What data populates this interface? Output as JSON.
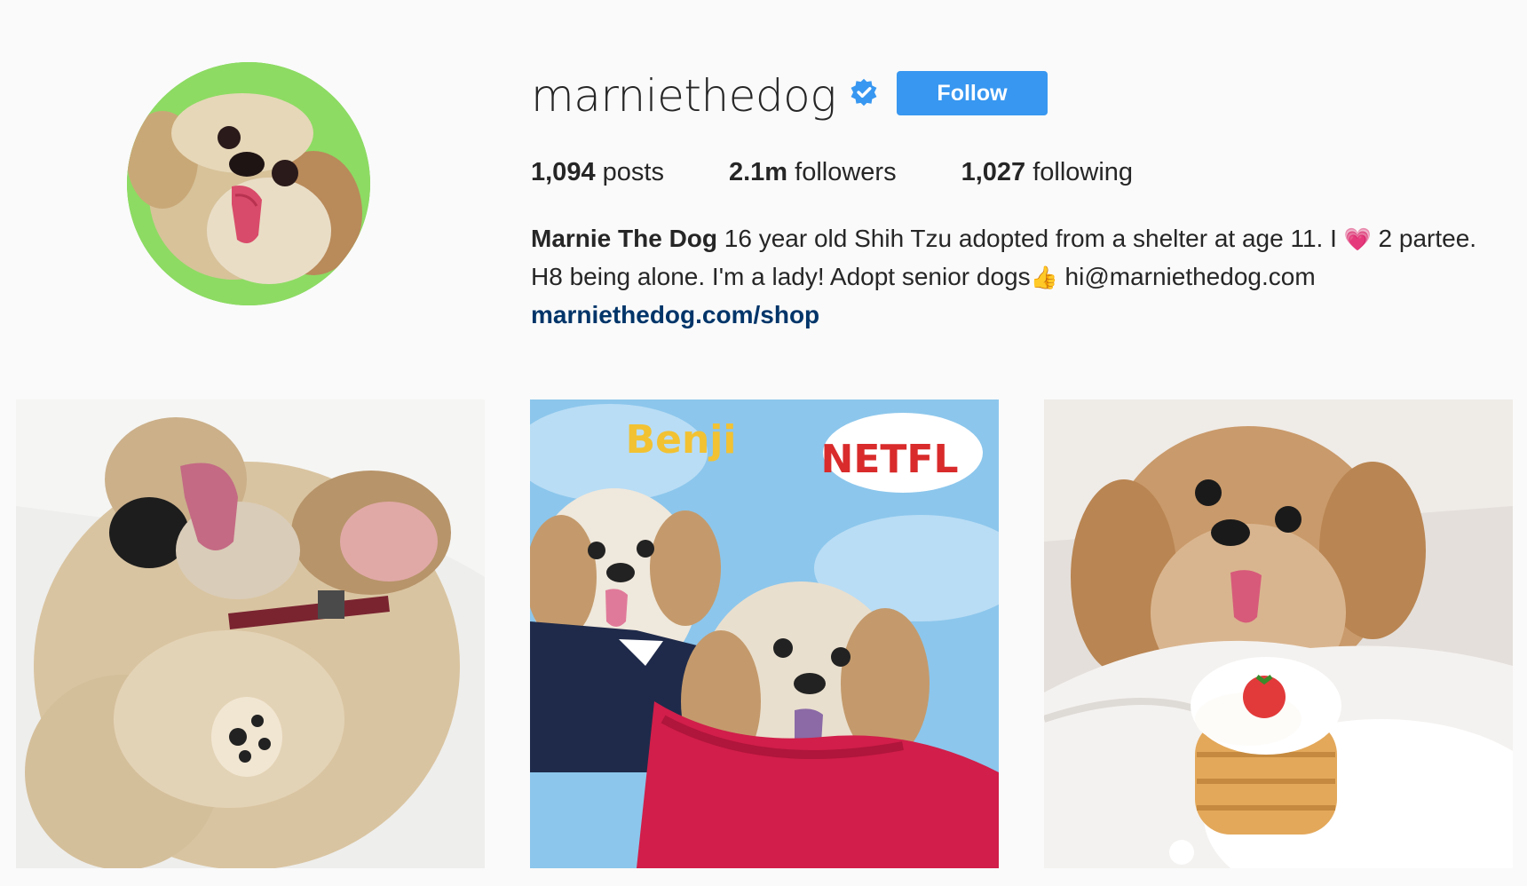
{
  "profile": {
    "username": "marniethedog",
    "verified": true,
    "follow_label": "Follow",
    "accent_color": "#3897f0",
    "link_color": "#003569"
  },
  "stats": {
    "posts_count": "1,094",
    "posts_label": "posts",
    "followers_count": "2.1m",
    "followers_label": "followers",
    "following_count": "1,027",
    "following_label": "following"
  },
  "bio": {
    "name": "Marnie The Dog",
    "text_part1": "16 year old Shih Tzu adopted from a shelter at age 11. I ",
    "emoji_heart": "💗",
    "text_part2": "  2 partee. H8 being alone. I'm a lady! Adopt senior dogs",
    "emoji_thumb": "👍",
    "email": "  hi@marniethedog.com",
    "link": "marniethedog.com/shop"
  },
  "posts": [
    {
      "icon": "dog-on-bed-photo"
    },
    {
      "icon": "dogs-at-netflix-event-photo",
      "signage_text": "NETFL",
      "signage_text_2": "Benji"
    },
    {
      "icon": "dog-with-pancakes-photo"
    }
  ]
}
